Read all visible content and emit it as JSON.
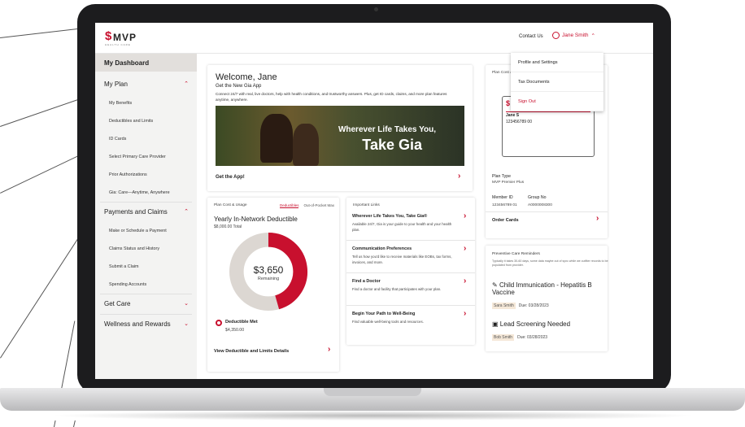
{
  "header": {
    "logo_text": "MVP",
    "logo_sub": "HEALTH CARE",
    "contact": "Contact Us",
    "user_name": "Jane Smith"
  },
  "user_menu": {
    "items": [
      "Profile and Settings",
      "Tax Documents",
      "Sign Out"
    ]
  },
  "sidebar": {
    "dashboard": "My Dashboard",
    "my_plan": "My Plan",
    "plan_items": [
      "My Benefits",
      "Deductibles and Limits",
      "ID Cards",
      "Select Primary Care Provider",
      "Prior Authorizations",
      "Gia: Care—Anytime, Anywhere"
    ],
    "payments": "Payments and Claims",
    "payment_items": [
      "Make or Schedule a Payment",
      "Claims Status and History",
      "Submit a Claim",
      "Spending Accounts"
    ],
    "get_care": "Get Care",
    "wellness": "Wellness and Rewards"
  },
  "welcome": {
    "title": "Welcome, Jane",
    "subtitle": "Get the New Gia App",
    "text": "Connect 24/7 with real, live doctors, help with health conditions, and trustworthy answers. Plus, get ID cards, claims, and more plan features anytime, anywhere.",
    "banner_line1": "Wherever Life Takes You,",
    "banner_line2": "Take Gia",
    "cta": "Get the App!"
  },
  "deductible": {
    "header": "Plan Cost & Usage",
    "tab_active": "Deductibles",
    "tab_other": "Out-of-Pocket Max",
    "title": "Yearly In-Network Deductible",
    "total": "$8,000.00 Total",
    "remaining_amount": "$3,650",
    "remaining_label": "Remaining",
    "met_label": "Deductible Met",
    "met_amount": "$4,350.00",
    "remaining_fraction": 0.456,
    "link": "View Deductible and Limits Details"
  },
  "links": {
    "header": "Important Links",
    "items": [
      {
        "title": "Wherever Life Takes You, Take Gia®",
        "desc": "Available 24/7, Gia is your guide to your health and your health plan."
      },
      {
        "title": "Communication Preferences",
        "desc": "Tell us how you'd like to receive materials like EOBs, tax forms, invoices, and more."
      },
      {
        "title": "Find a Doctor",
        "desc": "Find a doctor and facility that participates with your plan."
      },
      {
        "title": "Begin Your Path to Well-Being",
        "desc": "Find valuable well-being tools and resources."
      }
    ]
  },
  "plan_card": {
    "header": "Plan Cost &",
    "card_name": "Jane S",
    "card_id": "123456789 00",
    "card_label": "Member ID",
    "plan_type_label": "Plan Type",
    "plan_type": "MVP Premier Plus",
    "member_id_label": "Member ID",
    "member_id": "123456789 01",
    "group_label": "Group No",
    "group_no": "A0000008300",
    "order": "Order Cards"
  },
  "reminders": {
    "header": "Preventive Care Reminders",
    "note": "Typically it takes 30-60 days, some data maybe out of sync while we outfiter records to be populated from provider.",
    "items": [
      {
        "title": "Child Immunication - Hepatitis B Vaccine",
        "person": "Sara Smith",
        "due": "Due: 03/28/2023"
      },
      {
        "title": "Lead Screening Needed",
        "person": "Bob Smith",
        "due": "Due: 03/28/2023"
      }
    ]
  },
  "colors": {
    "accent": "#c8102e",
    "donut_bg": "#dcd7d2"
  }
}
